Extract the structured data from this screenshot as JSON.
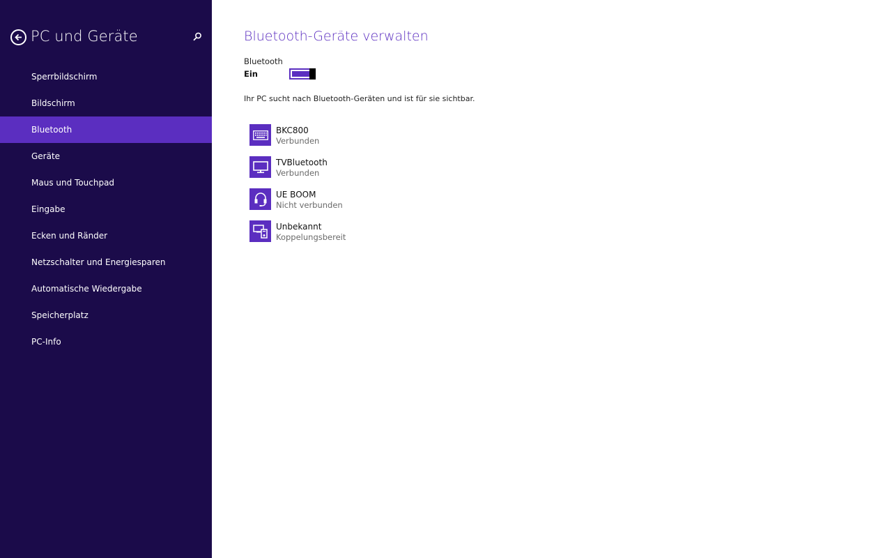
{
  "sidebar": {
    "title": "PC und Geräte",
    "back_icon": "back-arrow-icon",
    "search_icon": "search-icon",
    "items": [
      {
        "label": "Sperrbildschirm"
      },
      {
        "label": "Bildschirm"
      },
      {
        "label": "Bluetooth",
        "active": true
      },
      {
        "label": "Geräte"
      },
      {
        "label": "Maus und Touchpad"
      },
      {
        "label": "Eingabe"
      },
      {
        "label": "Ecken und Ränder"
      },
      {
        "label": "Netzschalter und Energiesparen"
      },
      {
        "label": "Automatische Wiedergabe"
      },
      {
        "label": "Speicherplatz"
      },
      {
        "label": "PC-Info"
      }
    ]
  },
  "main": {
    "title": "Bluetooth-Geräte verwalten",
    "bluetooth_label": "Bluetooth",
    "bluetooth_state": "Ein",
    "bluetooth_on": true,
    "description": "Ihr PC sucht nach Bluetooth-Geräten und ist für sie sichtbar.",
    "devices": [
      {
        "name": "BKC800",
        "status": "Verbunden",
        "icon": "keyboard-icon"
      },
      {
        "name": "TVBluetooth",
        "status": "Verbunden",
        "icon": "monitor-icon"
      },
      {
        "name": "UE BOOM",
        "status": "Nicht verbunden",
        "icon": "headset-icon"
      },
      {
        "name": "Unbekannt",
        "status": "Koppelungsbereit",
        "icon": "devices-icon"
      }
    ]
  },
  "colors": {
    "sidebar_bg": "#1b0b4a",
    "accent": "#5b2ec0"
  }
}
